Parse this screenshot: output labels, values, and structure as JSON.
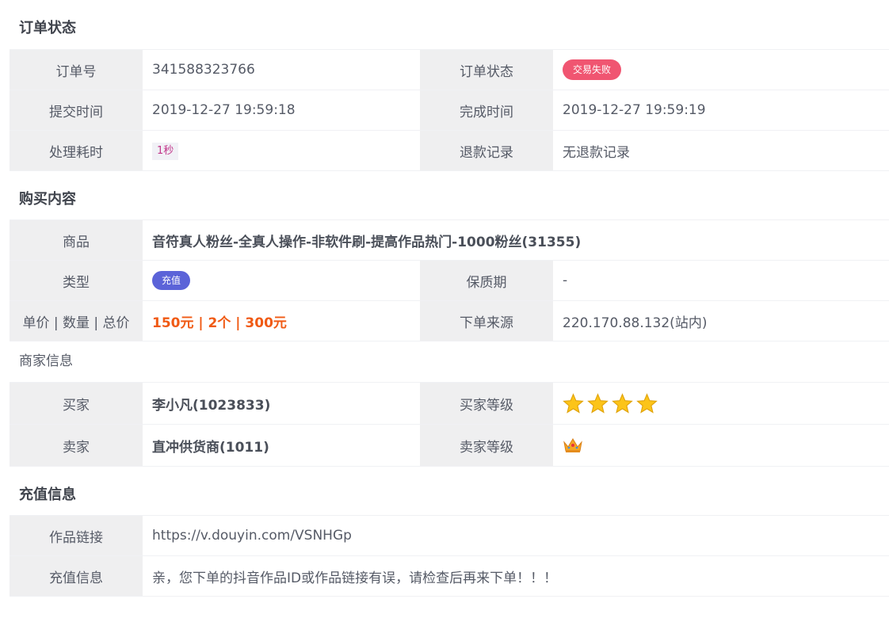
{
  "order_status_section": {
    "title": "订单状态",
    "order_no_label": "订单号",
    "order_no": "341588323766",
    "status_label": "订单状态",
    "status_badge": "交易失败",
    "submit_time_label": "提交时间",
    "submit_time": "2019-12-27 19:59:18",
    "finish_time_label": "完成时间",
    "finish_time": "2019-12-27 19:59:19",
    "duration_label": "处理耗时",
    "duration": "1秒",
    "refund_label": "退款记录",
    "refund": "无退款记录"
  },
  "purchase_section": {
    "title": "购买内容",
    "product_label": "商品",
    "product": "音符真人粉丝-全真人操作-非软件刷-提高作品热门-1000粉丝(31355)",
    "type_label": "类型",
    "type_badge": "充值",
    "warranty_label": "保质期",
    "warranty": "-",
    "price_label": "单价 | 数量 | 总价",
    "price": "150元 | 2个 | 300元",
    "source_label": "下单来源",
    "source": "220.170.88.132(站内)"
  },
  "merchant_section": {
    "title": "商家信息",
    "buyer_label": "买家",
    "buyer": "李小凡(1023833)",
    "buyer_level_label": "买家等级",
    "buyer_level_stars": 4,
    "seller_label": "卖家",
    "seller": "直冲供货商(1011)",
    "seller_level_label": "卖家等级",
    "seller_level_icon": "crown-icon"
  },
  "recharge_section": {
    "title": "充值信息",
    "link_label": "作品链接",
    "link": "https://v.douyin.com/VSNHGp",
    "info_label": "充值信息",
    "info": "亲，您下单的抖音作品ID或作品链接有误，请检查后再来下单！！！"
  },
  "colors": {
    "fail_badge": "#f05571",
    "type_badge": "#5b63d8",
    "price_text": "#f05a14",
    "label_bg": "#efeff0"
  }
}
